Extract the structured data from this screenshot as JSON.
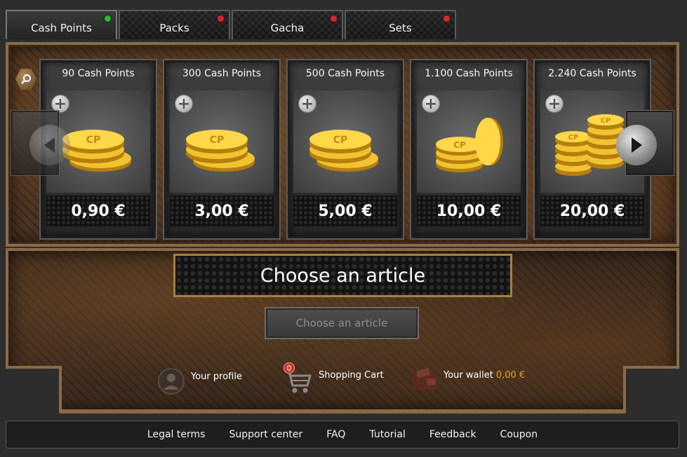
{
  "tabs": [
    {
      "label": "Cash Points",
      "status_color": "#26c12b"
    },
    {
      "label": "Packs",
      "status_color": "#d8252b"
    },
    {
      "label": "Gacha",
      "status_color": "#d8252b"
    },
    {
      "label": "Sets",
      "status_color": "#d8252b"
    }
  ],
  "products": [
    {
      "title": "90 Cash Points",
      "price": "0,90 €",
      "coin_stack": "small"
    },
    {
      "title": "300 Cash Points",
      "price": "3,00 €",
      "coin_stack": "small"
    },
    {
      "title": "500 Cash Points",
      "price": "5,00 €",
      "coin_stack": "small"
    },
    {
      "title": "1.100 Cash Points",
      "price": "10,00 €",
      "coin_stack": "medium"
    },
    {
      "title": "2.240 Cash Points",
      "price": "20,00 €",
      "coin_stack": "large"
    }
  ],
  "coin_label": "CP",
  "detail": {
    "title": "Choose an article",
    "button_label": "Choose an article"
  },
  "info": {
    "profile_label": "Your profile",
    "cart_label": "Shopping Cart",
    "cart_count": "0",
    "wallet_label": "Your wallet",
    "wallet_amount": "0,00 €"
  },
  "footer": {
    "links": [
      "Legal terms",
      "Support center",
      "FAQ",
      "Tutorial",
      "Feedback",
      "Coupon"
    ]
  },
  "colors": {
    "accent_gold": "#e4a22c",
    "frame_copper": "#8a6a48"
  }
}
